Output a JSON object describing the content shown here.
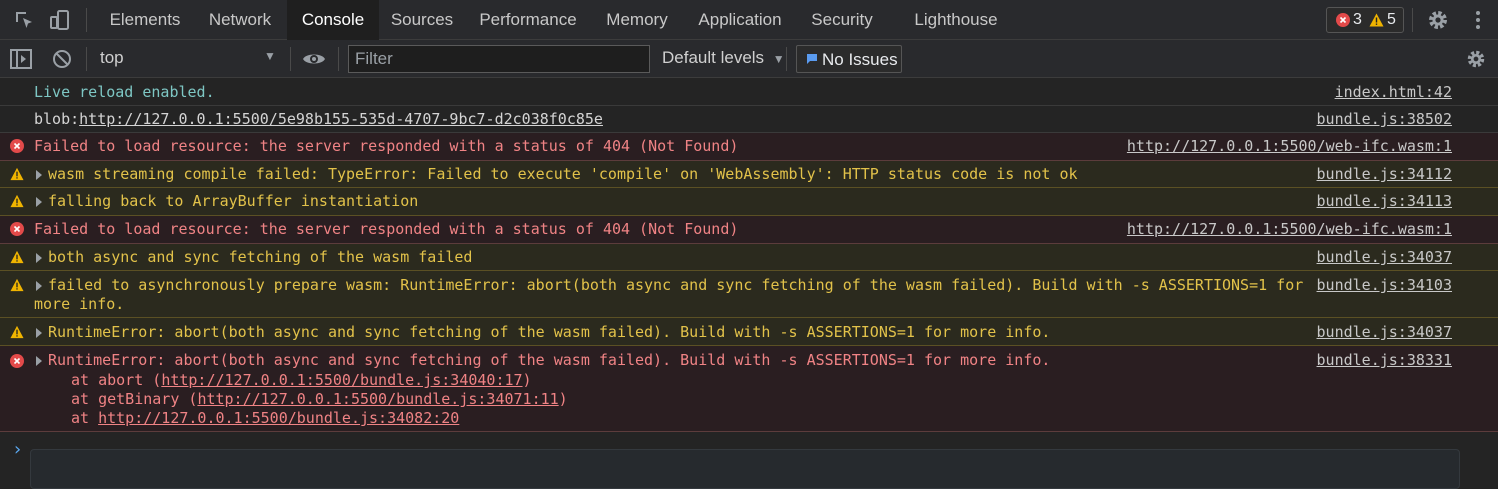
{
  "tabs": [
    "Elements",
    "Network",
    "Console",
    "Sources",
    "Performance",
    "Memory",
    "Application",
    "Security",
    "Lighthouse"
  ],
  "active_tab": "Console",
  "badges": {
    "errors": "3",
    "warnings": "5"
  },
  "toolbar": {
    "context": "top",
    "filter_placeholder": "Filter",
    "levels": "Default levels",
    "issues": "No Issues"
  },
  "icons": [
    "inspect-element-icon",
    "device-toolbar-icon",
    "settings-gear-icon",
    "more-menu-icon",
    "sidebar-toggle-icon",
    "clear-console-icon",
    "live-expression-eye-icon",
    "console-settings-gear-icon"
  ],
  "colors": {
    "error": "#f08385",
    "warning": "#e2c24a",
    "info": "#7ec7c4",
    "prompt": "#5aa8f0"
  },
  "console": {
    "live_reload": {
      "text": "Live reload enabled.",
      "source": "index.html:42"
    },
    "blob": {
      "prefix": "blob:",
      "url": "http://127.0.0.1:5500/5e98b155-535d-4707-9bc7-d2c038f0c85e",
      "source": "bundle.js:38502"
    },
    "err1": {
      "text": "Failed to load resource: the server responded with a status of 404 (Not Found)",
      "source": "http://127.0.0.1:5500/web-ifc.wasm:1"
    },
    "warn1": {
      "text": "wasm streaming compile failed: TypeError: Failed to execute 'compile' on 'WebAssembly': HTTP status code is not ok",
      "source": "bundle.js:34112"
    },
    "warn2": {
      "text": "falling back to ArrayBuffer instantiation",
      "source": "bundle.js:34113"
    },
    "err2": {
      "text": "Failed to load resource: the server responded with a status of 404 (Not Found)",
      "source": "http://127.0.0.1:5500/web-ifc.wasm:1"
    },
    "warn3": {
      "text": "both async and sync fetching of the wasm failed",
      "source": "bundle.js:34037"
    },
    "warn4": {
      "line1": "failed to asynchronously prepare wasm: RuntimeError: abort(both async and sync fetching of the wasm failed). Build with -s ASSERTIONS=1 for",
      "line2": "more info.",
      "source": "bundle.js:34103"
    },
    "warn5": {
      "text": "RuntimeError: abort(both async and sync fetching of the wasm failed). Build with -s ASSERTIONS=1 for more info.",
      "source": "bundle.js:34037"
    },
    "err3": {
      "text": "RuntimeError: abort(both async and sync fetching of the wasm failed). Build with -s ASSERTIONS=1 for more info.",
      "source": "bundle.js:38331",
      "stack": [
        {
          "prefix": "at abort (",
          "url": "http://127.0.0.1:5500/bundle.js:34040:17",
          "suffix": ")"
        },
        {
          "prefix": "at getBinary (",
          "url": "http://127.0.0.1:5500/bundle.js:34071:11",
          "suffix": ")"
        },
        {
          "prefix": "at ",
          "url": "http://127.0.0.1:5500/bundle.js:34082:20",
          "suffix": ""
        }
      ]
    },
    "prompt": "›"
  }
}
